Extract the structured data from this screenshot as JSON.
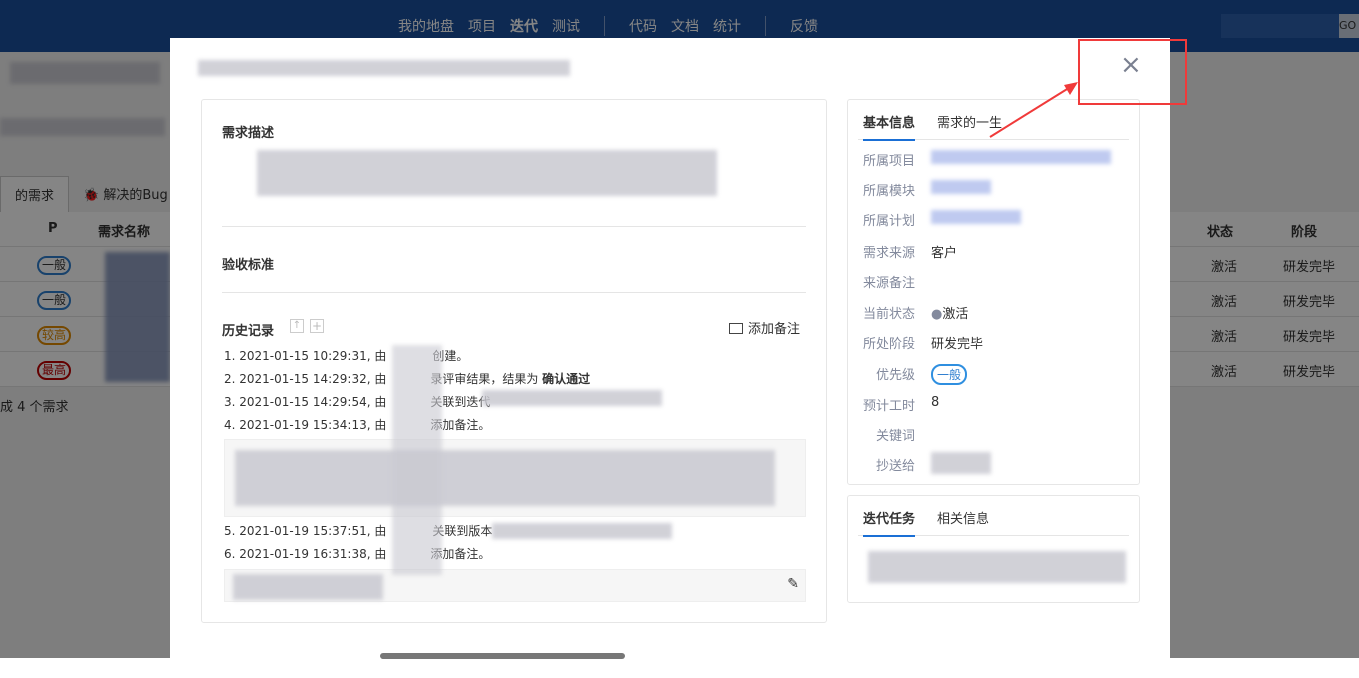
{
  "nav": {
    "items": [
      "我的地盘",
      "项目",
      "迭代",
      "测试",
      "代码",
      "文档",
      "统计",
      "反馈"
    ],
    "active": "迭代",
    "search_button": "GO"
  },
  "background": {
    "tabs": [
      "的需求",
      "解决的Bug"
    ],
    "columns": {
      "p": "P",
      "name": "需求名称",
      "status": "状态",
      "stage": "阶段"
    },
    "rows": [
      {
        "pri": "一般",
        "status": "激活",
        "stage": "研发完毕"
      },
      {
        "pri": "一般",
        "status": "激活",
        "stage": "研发完毕"
      },
      {
        "pri": "较高",
        "status": "激活",
        "stage": "研发完毕"
      },
      {
        "pri": "最高",
        "status": "激活",
        "stage": "研发完毕"
      }
    ],
    "footer": "成 4 个需求",
    "colors": {
      "normal": "#2f7fd0",
      "high": "#e08a00",
      "highest": "#c00000"
    }
  },
  "modal": {
    "close": "×",
    "desc_title": "需求描述",
    "accept_title": "验收标准",
    "history_title": "历史记录",
    "add_note": "添加备注",
    "history": [
      {
        "prefix": "1. 2021-01-15 10:29:31, 由",
        "suffix": "创建。"
      },
      {
        "prefix": "2. 2021-01-15 14:29:32, 由",
        "suffix": "录评审结果，结果为 ",
        "bold": "确认通过"
      },
      {
        "prefix": "3. 2021-01-15 14:29:54, 由",
        "suffix": "关联到迭代"
      },
      {
        "prefix": "4. 2021-01-19 15:34:13, 由",
        "suffix": "添加备注。"
      },
      {
        "prefix": "5. 2021-01-19 15:37:51, 由",
        "suffix": "关联到版本"
      },
      {
        "prefix": "6. 2021-01-19 16:31:38, 由",
        "suffix": "添加备注。"
      }
    ],
    "info_tabs": [
      "基本信息",
      "需求的一生"
    ],
    "info": [
      {
        "label": "所属项目",
        "value": ""
      },
      {
        "label": "所属模块",
        "value": ""
      },
      {
        "label": "所属计划",
        "value": ""
      },
      {
        "label": "需求来源",
        "value": "客户"
      },
      {
        "label": "来源备注",
        "value": ""
      },
      {
        "label": "当前状态",
        "value": "激活"
      },
      {
        "label": "所处阶段",
        "value": "研发完毕"
      },
      {
        "label": "优先级",
        "value": "一般"
      },
      {
        "label": "预计工时",
        "value": "8"
      },
      {
        "label": "关键词",
        "value": ""
      },
      {
        "label": "抄送给",
        "value": ""
      }
    ],
    "task_tabs": [
      "迭代任务",
      "相关信息"
    ]
  },
  "annotation": {
    "color": "#f03a3a"
  }
}
